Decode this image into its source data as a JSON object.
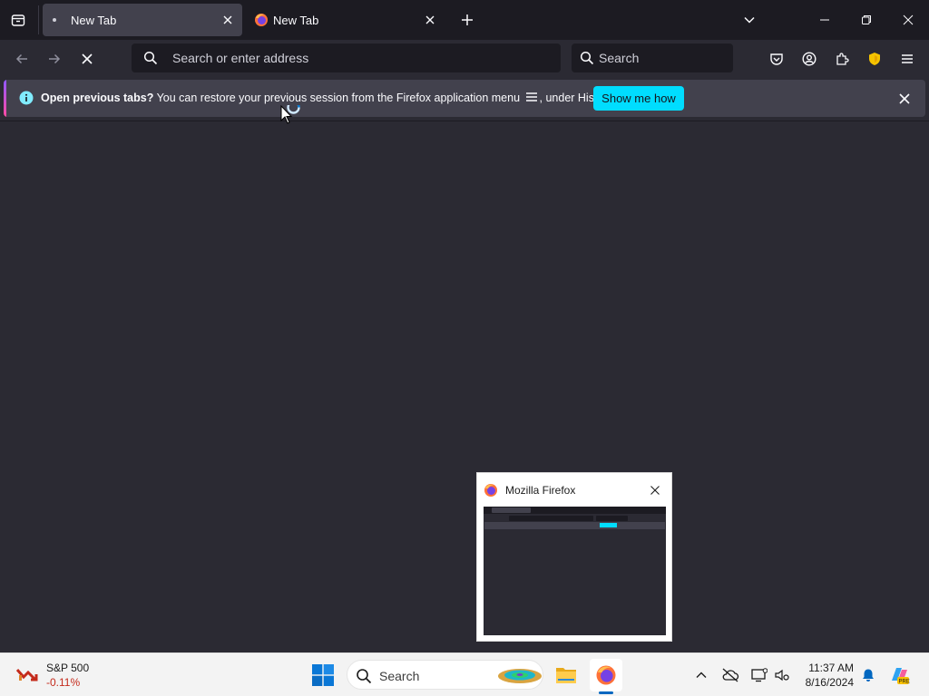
{
  "tabs": [
    {
      "title": "New Tab",
      "active": true
    },
    {
      "title": "New Tab",
      "active": false
    }
  ],
  "urlbar": {
    "placeholder": "Search or enter address"
  },
  "searchbar": {
    "placeholder": "Search"
  },
  "notification": {
    "bold": "Open previous tabs?",
    "text_before_icon": " You can restore your previous session from the Firefox application menu",
    "text_after_icon": ", under History.",
    "button": "Show me how"
  },
  "preview": {
    "title": "Mozilla Firefox"
  },
  "taskbar": {
    "widget": {
      "name": "S&P 500",
      "change": "-0.11%"
    },
    "search_placeholder": "Search",
    "clock": {
      "time": "11:37 AM",
      "date": "8/16/2024"
    }
  },
  "colors": {
    "accent": "#00ddff",
    "negative": "#c42b1c",
    "chrome_dark": "#1c1b22",
    "content": "#2b2a33"
  }
}
